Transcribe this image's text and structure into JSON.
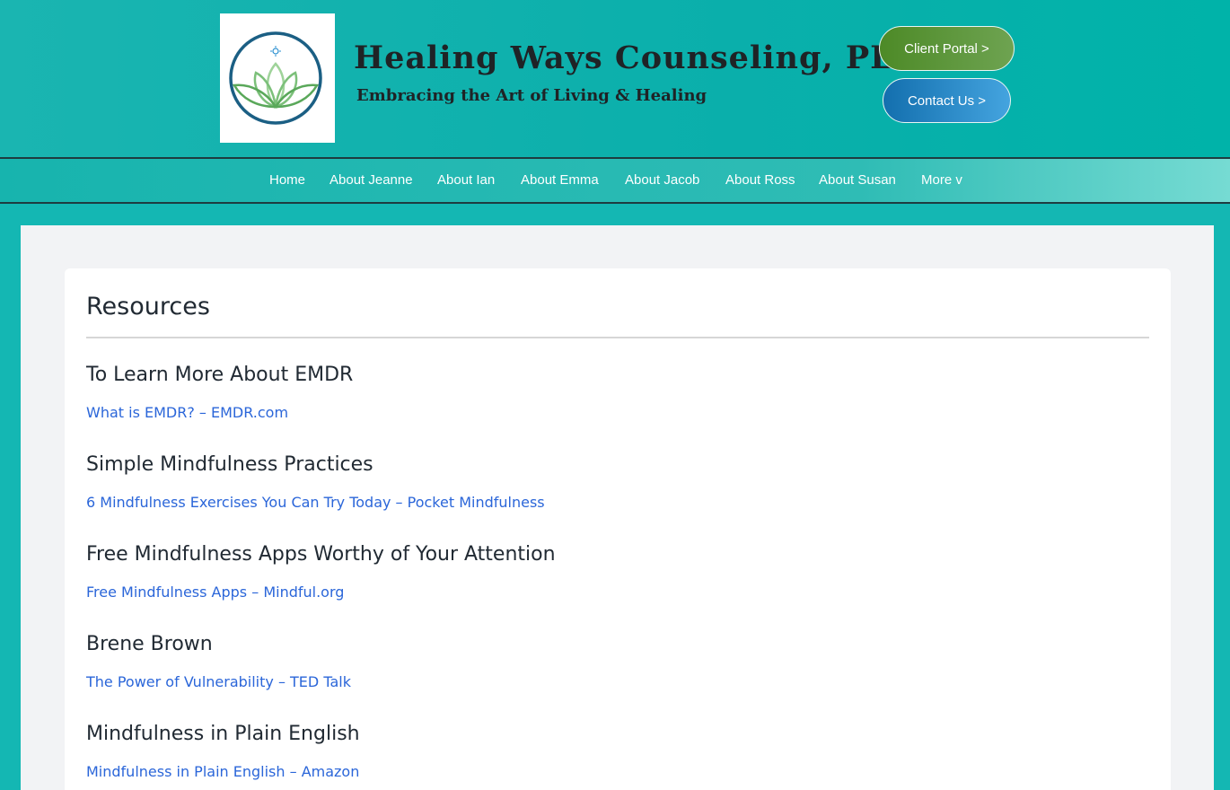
{
  "header": {
    "site_title": "Healing Ways Counseling, PLC",
    "tagline": "Embracing the Art of Living & Healing",
    "client_portal_label": "Client Portal >",
    "contact_us_label": "Contact Us >",
    "logo_icon": "lotus-logo"
  },
  "nav": {
    "items": [
      {
        "label": "Home"
      },
      {
        "label": "About Jeanne"
      },
      {
        "label": "About Ian"
      },
      {
        "label": "About Emma"
      },
      {
        "label": "About Jacob"
      },
      {
        "label": "About Ross"
      },
      {
        "label": "About Susan"
      },
      {
        "label": "More v"
      }
    ]
  },
  "main": {
    "title": "Resources",
    "sections": [
      {
        "heading": "To Learn More About EMDR",
        "link": "What is EMDR? – EMDR.com"
      },
      {
        "heading": "Simple Mindfulness Practices",
        "link": "6 Mindfulness Exercises You Can Try Today – Pocket Mindfulness"
      },
      {
        "heading": "Free Mindfulness Apps Worthy of Your Attention",
        "link": "Free Mindfulness Apps – Mindful.org"
      },
      {
        "heading": "Brene Brown",
        "link": "The Power of Vulnerability – TED Talk"
      },
      {
        "heading": "Mindfulness in Plain English",
        "link": "Mindfulness in Plain English – Amazon"
      }
    ]
  },
  "colors": {
    "page_background": "#14b7b3",
    "title_text": "#1f2326",
    "link": "#2b66d9",
    "portal_button": "#5a952f",
    "contact_button": "#2a87c6"
  }
}
